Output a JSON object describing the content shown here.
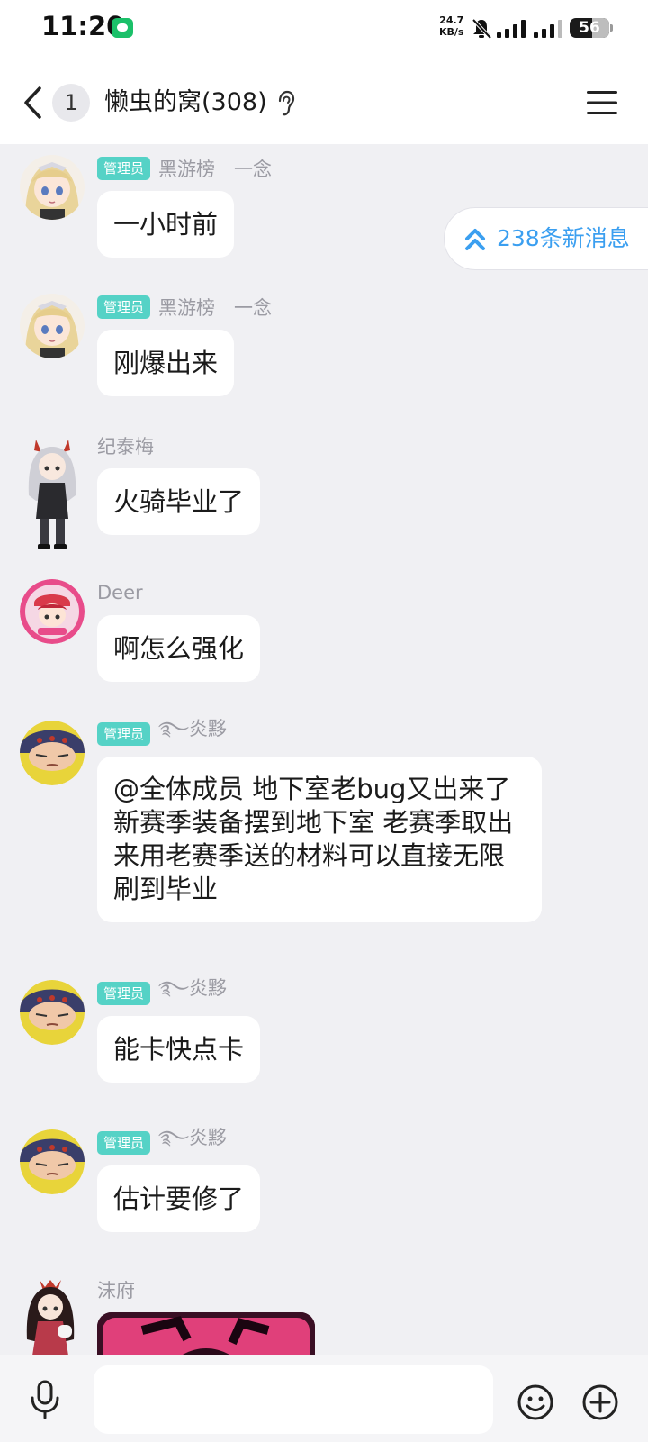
{
  "status_bar": {
    "time": "11:20",
    "net_speed_value": "24.7",
    "net_speed_unit": "KB/s",
    "battery": "56",
    "battery_level": 0.56
  },
  "header": {
    "unread_count": "1",
    "title": "懒虫的窝(308)"
  },
  "new_messages_label": "238条新消息",
  "messages": [
    {
      "badge": "管理员",
      "name": "黑游榜　一念",
      "text": "一小时前",
      "avatar": "blonde-girl-avatar"
    },
    {
      "badge": "管理员",
      "name": "黑游榜　一念",
      "text": "刚爆出来",
      "avatar": "blonde-girl-avatar"
    },
    {
      "badge": "",
      "name": "纪泰梅",
      "text": "火骑毕业了",
      "avatar": "silver-hair-chibi-avatar"
    },
    {
      "badge": "",
      "name": "Deer",
      "text": "啊怎么强化",
      "avatar": "pink-circle-avatar"
    },
    {
      "badge": "管理员",
      "name": "࿐炎黟",
      "text": "@全体成员 地下室老bug又出来了 新赛季装备摆到地下室 老赛季取出来用老赛季送的材料可以直接无限刷到毕业",
      "avatar": "yellow-face-avatar"
    },
    {
      "badge": "管理员",
      "name": "࿐炎黟",
      "text": "能卡快点卡",
      "avatar": "yellow-face-avatar"
    },
    {
      "badge": "管理员",
      "name": "࿐炎黟",
      "text": "估计要修了",
      "avatar": "yellow-face-avatar"
    },
    {
      "badge": "",
      "name": "沫府",
      "text": "",
      "avatar": "dark-hair-chibi-avatar"
    }
  ],
  "colors": {
    "badge": "#55d2c6",
    "link_blue": "#3b9ff0",
    "chat_bg": "#f0f0f3"
  },
  "input": {
    "placeholder": ""
  }
}
